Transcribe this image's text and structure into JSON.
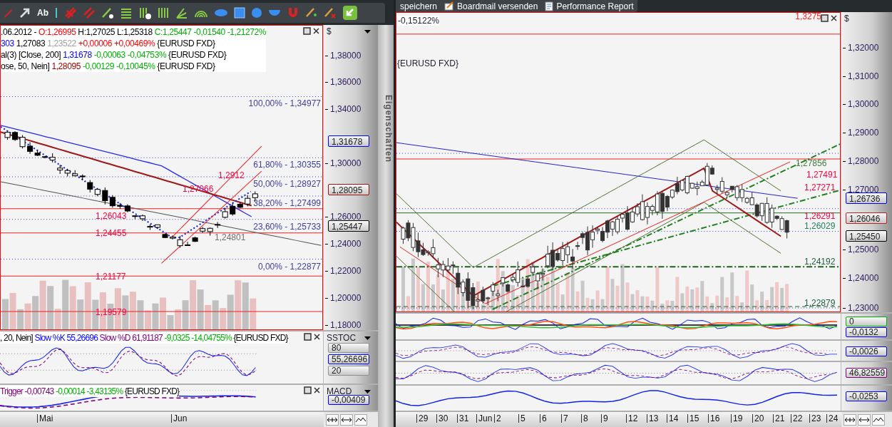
{
  "left_toolbar": {
    "text_tool": "Ab"
  },
  "left_chart": {
    "legend": [
      [
        {
          "text": ".06.2012 - ",
          "color": "#000000"
        },
        {
          "text": "O:1,26995",
          "color": "#ff0000"
        },
        {
          "text": " H:1,27025 L:1,25318 ",
          "color": "#000000"
        },
        {
          "text": "C:1,25447 -0,01540 -1,21272%",
          "color": "#00b000"
        }
      ],
      [
        {
          "text": "303",
          "color": "#0000ff"
        },
        {
          "text": " 1,27083 ",
          "color": "#000000"
        },
        {
          "text": "1,23522",
          "color": "#a0a0a0"
        },
        {
          "text": " +0,00006 +0,00469%",
          "color": "#ff0000"
        },
        {
          "text": " {EURUSD FXD}",
          "color": "#000000"
        }
      ],
      [
        {
          "text": "al(3) [Close, 200] ",
          "color": "#000000"
        },
        {
          "text": "1,31678",
          "color": "#0000ff"
        },
        {
          "text": " -0,00063 -0,04753%",
          "color": "#00b000"
        },
        {
          "text": " {EURUSD FXD}",
          "color": "#000000"
        }
      ],
      [
        {
          "text": "ose, 50, Nein] ",
          "color": "#000000"
        },
        {
          "text": "1,28095",
          "color": "#a00000"
        },
        {
          "text": " -0,00129 -0,10045%",
          "color": "#00b000"
        },
        {
          "text": " {EURUSD FXD}",
          "color": "#000000"
        }
      ]
    ],
    "currency": "$",
    "y_labels": [
      "1,38000",
      "1,36000",
      "1,34000",
      "1,30000",
      "1,26000",
      "1,24000",
      "1,22000",
      "1,20000",
      "1,18000"
    ],
    "price_tags": [
      {
        "value": "1,31678",
        "color": "#0000ff"
      },
      {
        "value": "1,28095",
        "color": "#a01010"
      },
      {
        "value": "1,25447",
        "color": "#000000"
      }
    ],
    "fib_labels": [
      "100,00% - 1,34977",
      "61,80% - 1,30355",
      "50,00% - 1,28927",
      "38,20% - 1,27499",
      "23,60% - 1,25733",
      "0,00% - 1,22877"
    ],
    "line_labels": [
      {
        "text": "1,2912",
        "color": "#ff0040"
      },
      {
        "text": "1,27066",
        "color": "#ff0040"
      },
      {
        "text": "1,26043",
        "color": "#ff0040"
      },
      {
        "text": "1,24455",
        "color": "#ff0040"
      },
      {
        "text": "1,24801",
        "color": "#707070"
      },
      {
        "text": "1,21177",
        "color": "#ff0040"
      },
      {
        "text": "1,19579",
        "color": "#ff0040"
      }
    ]
  },
  "left_indicators": [
    {
      "kind": "stoch",
      "name": "SSTOC",
      "legend": [
        {
          "text": ", 20, Nein] ",
          "color": "#000000"
        },
        {
          "text": "Slow %K 55,26696",
          "color": "#0000ff"
        },
        {
          "text": " Slow %D 61,91187",
          "color": "#800080"
        },
        {
          "text": " -9,0325 -14,04755%",
          "color": "#00b000"
        },
        {
          "text": " {EURUSD FXD}",
          "color": "#000000"
        }
      ],
      "tags": [
        {
          "value": "80",
          "color": "#909090"
        },
        {
          "value": "55,26696",
          "color": "#0000ff"
        },
        {
          "value": "20",
          "color": "#909090"
        }
      ]
    },
    {
      "kind": "macd",
      "name": "MACD",
      "legend": [
        {
          "text": "Trigger -0,00743",
          "color": "#800080"
        },
        {
          "text": " -0,00014 -3,43135%",
          "color": "#00b000"
        },
        {
          "text": " {EURUSD FXD}",
          "color": "#000000"
        }
      ],
      "tags": [
        {
          "value": "-0,00409",
          "color": "#0000ff"
        }
      ]
    }
  ],
  "left_x_labels": [
    "Mai",
    "Jun"
  ],
  "sidebar_tab": "Eigenschaften",
  "right_toolbar": {
    "buttons": [
      "speichern",
      "Boardmail versenden",
      "Performance Report"
    ]
  },
  "right_chart": {
    "change": "-0,15122%",
    "top_value": "1,3275",
    "symbol": "{EURUSD FXD}",
    "currency": "$",
    "y_labels": [
      "1,32000",
      "1,31000",
      "1,30000",
      "1,29000",
      "1,28000",
      "1,27000",
      "1,25000",
      "1,24000",
      "1,23000"
    ],
    "price_tags": [
      {
        "value": "1,26736",
        "color": "#0000ff"
      },
      {
        "value": "1,26046",
        "color": "#c02020"
      },
      {
        "value": "1,25450",
        "color": "#000000"
      }
    ],
    "line_labels": [
      {
        "text": "1,27856",
        "color": "#408040"
      },
      {
        "text": "1,27491",
        "color": "#ff0040"
      },
      {
        "text": "1,27271",
        "color": "#ff0040"
      },
      {
        "text": "1,26291",
        "color": "#ff0040"
      },
      {
        "text": "1,26029",
        "color": "#208060"
      },
      {
        "text": "1,24192",
        "color": "#206040"
      },
      {
        "text": "1,22879",
        "color": "#206040"
      }
    ]
  },
  "right_indicators": [
    {
      "kind": "momentum",
      "tags": [
        {
          "value": "0",
          "color": "#00b000"
        },
        {
          "value": "-0,0132",
          "color": "#0000ff"
        }
      ]
    },
    {
      "kind": "stoch",
      "tags": [
        {
          "value": "-0,0026",
          "color": "#0000ff"
        }
      ]
    },
    {
      "kind": "stoch",
      "tags": [
        {
          "value": "46,82559",
          "color": "#800080"
        }
      ]
    },
    {
      "kind": "line",
      "tags": [
        {
          "value": "-0,0253",
          "color": "#0000ff"
        }
      ]
    }
  ],
  "right_x_labels": [
    "29",
    "30",
    "31",
    "Jun",
    "2",
    "5",
    "6",
    "7",
    "8",
    "9",
    "12",
    "13",
    "14",
    "15",
    "16",
    "19",
    "20",
    "21",
    "22",
    "23",
    "24"
  ]
}
